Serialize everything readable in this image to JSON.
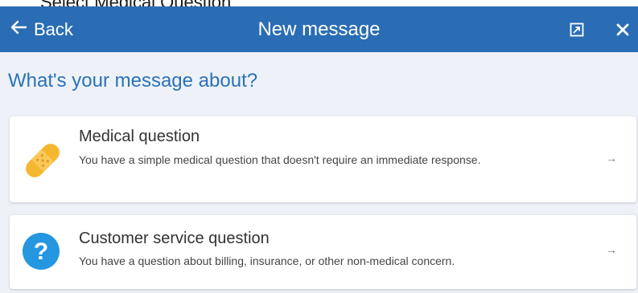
{
  "caption": "Select Medical Question",
  "header": {
    "back_label": "Back",
    "title": "New message"
  },
  "main": {
    "heading": "What's your message about?",
    "options": [
      {
        "title": "Medical question",
        "description": "You have a simple medical question that doesn't require an immediate response.",
        "icon": "bandage-icon",
        "arrow": "→"
      },
      {
        "title": "Customer service question",
        "description": "You have a question about billing, insurance, or other non-medical concern.",
        "icon": "question-mark-icon",
        "arrow": "→"
      }
    ]
  },
  "colors": {
    "header_bg": "#2a6db5",
    "content_bg": "#eef2f8",
    "heading_text": "#2a72b8",
    "bandage": "#f5b730",
    "question_circle": "#2596e0"
  }
}
